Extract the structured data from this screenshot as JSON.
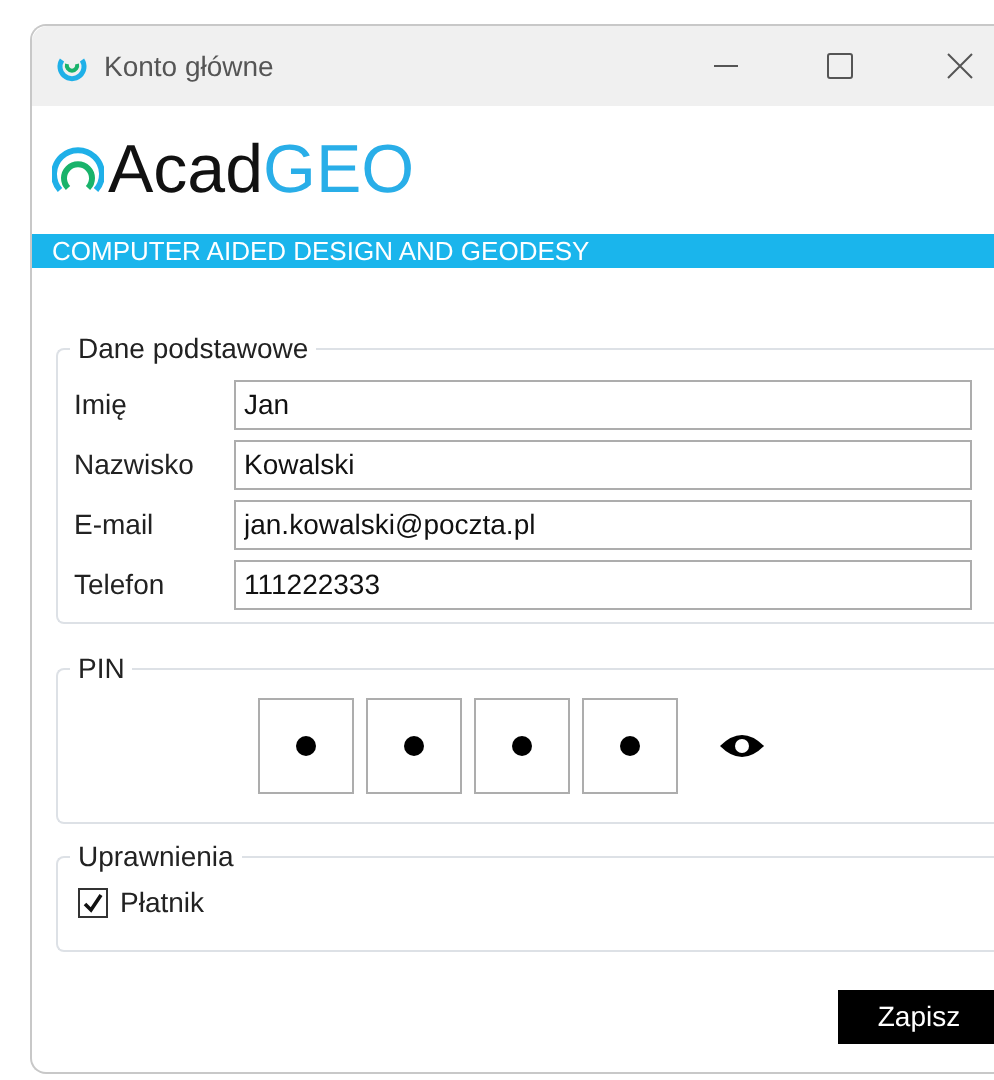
{
  "window": {
    "title": "Konto główne"
  },
  "logo": {
    "part_1": "Acad",
    "part_2": "GEO",
    "tagline": "COMPUTER AIDED DESIGN AND GEODESY"
  },
  "basic_data": {
    "legend": "Dane podstawowe",
    "fields": [
      {
        "label": "Imię",
        "value": "Jan"
      },
      {
        "label": "Nazwisko",
        "value": "Kowalski"
      },
      {
        "label": "E-mail",
        "value": "jan.kowalski@poczta.pl"
      },
      {
        "label": "Telefon",
        "value": "111222333"
      }
    ]
  },
  "pin": {
    "legend": "PIN",
    "digits": [
      {
        "filled": true
      },
      {
        "filled": true
      },
      {
        "filled": true
      },
      {
        "filled": true
      }
    ]
  },
  "permissions": {
    "legend": "Uprawnienia",
    "items": [
      {
        "label": "Płatnik",
        "checked": true
      }
    ]
  },
  "buttons": [
    {
      "label": "Zapisz"
    }
  ]
}
